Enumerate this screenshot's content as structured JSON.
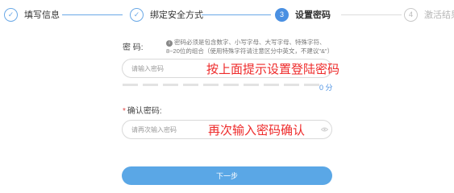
{
  "steps": [
    {
      "number": "✓",
      "label": "填写信息",
      "state": "done"
    },
    {
      "number": "✓",
      "label": "绑定安全方式",
      "state": "done"
    },
    {
      "number": "3",
      "label": "设置密码",
      "state": "active"
    },
    {
      "number": "4",
      "label": "激活结果",
      "state": "todo"
    }
  ],
  "form": {
    "password_label": "密 码:",
    "password_hint": "密码必须是包含数字、小写字母、大写字母、特殊字符、8~20位的组合（使用特殊字符请注意区分中英文，不建议\"&\"）",
    "password_placeholder": "请输入密码",
    "password_annotation": "按上面提示设置登陆密码",
    "strength_score": "0 分",
    "strength_segments": 10,
    "confirm_required_mark": "*",
    "confirm_label": "确认密码:",
    "confirm_placeholder": "请再次输入密码",
    "confirm_annotation": "再次输入密码确认",
    "next_button": "下一步"
  },
  "colors": {
    "accent": "#4a90e2",
    "button": "#5aa7e6",
    "annotation": "#ee2a2a",
    "required": "#e04848"
  },
  "icons": {
    "step_done": "check-circle-icon",
    "hint": "info-icon",
    "visibility": "eye-icon"
  }
}
